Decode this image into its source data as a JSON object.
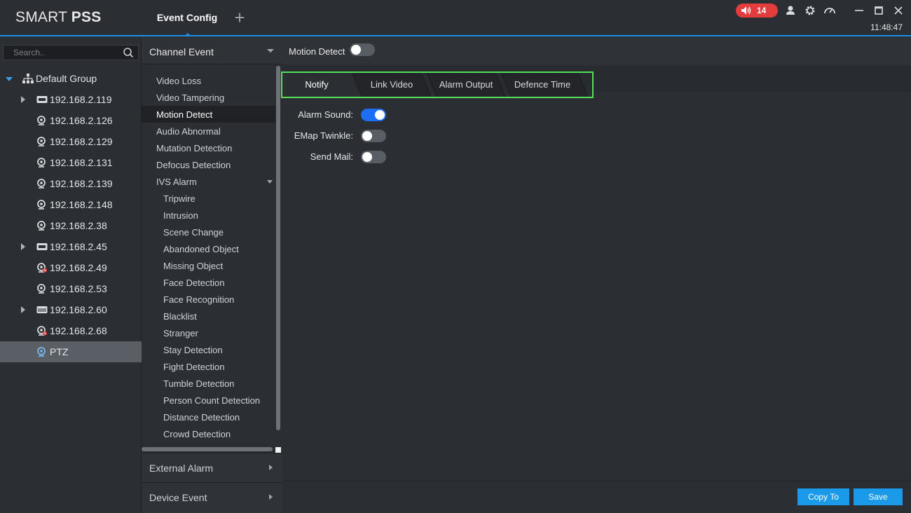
{
  "app": {
    "logo_light": "SMART ",
    "logo_bold": "PSS",
    "active_tab": "Event Config",
    "add_tab_glyph": "+",
    "alarm_count": "14",
    "clock": "11:48:47",
    "icons": [
      "speaker-icon",
      "user-icon",
      "gear-icon",
      "gauge-icon",
      "minimize-icon",
      "maximize-icon",
      "close-icon"
    ]
  },
  "devices": {
    "search_placeholder": "Search..",
    "group": "Default Group",
    "items": [
      {
        "label": "192.168.2.119",
        "kind": "nvr",
        "expandable": true
      },
      {
        "label": "192.168.2.126",
        "kind": "camera"
      },
      {
        "label": "192.168.2.129",
        "kind": "camera"
      },
      {
        "label": "192.168.2.131",
        "kind": "camera"
      },
      {
        "label": "192.168.2.139",
        "kind": "camera"
      },
      {
        "label": "192.168.2.148",
        "kind": "camera"
      },
      {
        "label": "192.168.2.38",
        "kind": "camera"
      },
      {
        "label": "192.168.2.45",
        "kind": "nvr",
        "expandable": true
      },
      {
        "label": "192.168.2.49",
        "kind": "camera-offline"
      },
      {
        "label": "192.168.2.53",
        "kind": "camera"
      },
      {
        "label": "192.168.2.60",
        "kind": "dvr",
        "expandable": true
      },
      {
        "label": "192.168.2.68",
        "kind": "camera-offline"
      },
      {
        "label": "PTZ",
        "kind": "camera-online",
        "selected": true
      }
    ]
  },
  "events": {
    "header": "Channel Event",
    "items": [
      {
        "label": "Video Loss"
      },
      {
        "label": "Video Tampering"
      },
      {
        "label": "Motion Detect",
        "selected": true
      },
      {
        "label": "Audio Abnormal"
      },
      {
        "label": "Mutation Detection"
      },
      {
        "label": "Defocus Detection"
      },
      {
        "label": "IVS Alarm",
        "expandable": true
      },
      {
        "label": "Tripwire",
        "sub": true
      },
      {
        "label": "Intrusion",
        "sub": true
      },
      {
        "label": "Scene Change",
        "sub": true
      },
      {
        "label": "Abandoned Object",
        "sub": true
      },
      {
        "label": "Missing Object",
        "sub": true
      },
      {
        "label": "Face Detection",
        "sub": true
      },
      {
        "label": "Face Recognition",
        "sub": true
      },
      {
        "label": "Blacklist",
        "sub": true
      },
      {
        "label": "Stranger",
        "sub": true
      },
      {
        "label": "Stay Detection",
        "sub": true
      },
      {
        "label": "Fight Detection",
        "sub": true
      },
      {
        "label": "Tumble Detection",
        "sub": true
      },
      {
        "label": "Person Count Detection",
        "sub": true
      },
      {
        "label": "Distance Detection",
        "sub": true
      },
      {
        "label": "Crowd Detection",
        "sub": true
      }
    ],
    "footer": [
      "External Alarm",
      "Device Event"
    ]
  },
  "main": {
    "title": "Motion Detect",
    "enabled": false,
    "tabs": [
      "Notify",
      "Link Video",
      "Alarm Output",
      "Defence Time"
    ],
    "active_tab": 0,
    "options": [
      {
        "label": "Alarm Sound:",
        "on": true
      },
      {
        "label": "EMap Twinkle:",
        "on": false
      },
      {
        "label": "Send Mail:",
        "on": false
      }
    ],
    "copy_label": "Copy To",
    "save_label": "Save"
  },
  "colors": {
    "accent": "#1e8fe6",
    "button": "#1a9ae8",
    "toggle_on": "#1c6ef2",
    "alarm": "#e23c3c",
    "highlight_frame": "#54e05a"
  }
}
